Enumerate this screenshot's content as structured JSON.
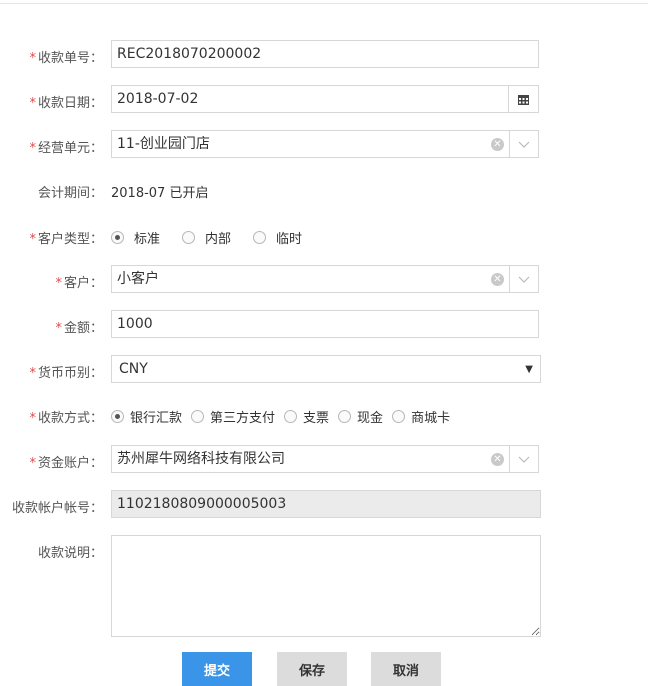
{
  "form": {
    "receipt_no": {
      "label": "收款单号：",
      "required_mark": "*",
      "value": "REC2018070200002"
    },
    "receipt_date": {
      "label": "收款日期：",
      "required_mark": "*",
      "value": "2018-07-02",
      "icon": "calendar-icon"
    },
    "business_unit": {
      "label": "经营单元：",
      "required_mark": "*",
      "value": "11-创业园门店"
    },
    "accounting_period": {
      "label": "会计期间：",
      "value": "2018-07 已开启"
    },
    "customer_type": {
      "label": "客户类型：",
      "required_mark": "*",
      "options": [
        "标准",
        "内部",
        "临时"
      ],
      "selected": "标准"
    },
    "customer": {
      "label": "客户：",
      "required_mark": "*",
      "value": "小客户"
    },
    "amount": {
      "label": "金额：",
      "required_mark": "*",
      "value": "1000"
    },
    "currency": {
      "label": "货币币别：",
      "required_mark": "*",
      "value": "CNY"
    },
    "payment_method": {
      "label": "收款方式：",
      "required_mark": "*",
      "options": [
        "银行汇款",
        "第三方支付",
        "支票",
        "现金",
        "商城卡"
      ],
      "selected": "银行汇款"
    },
    "fund_account": {
      "label": "资金账户：",
      "required_mark": "*",
      "value": "苏州犀牛网络科技有限公司"
    },
    "account_number": {
      "label": "收款帐户帐号：",
      "value": "1102180809000005003"
    },
    "remark": {
      "label": "收款说明：",
      "value": ""
    }
  },
  "buttons": {
    "submit": "提交",
    "save": "保存",
    "cancel": "取消"
  },
  "colors": {
    "required": "#e04a4a",
    "primary": "#3a95e8",
    "secondary": "#dcdcdc"
  }
}
